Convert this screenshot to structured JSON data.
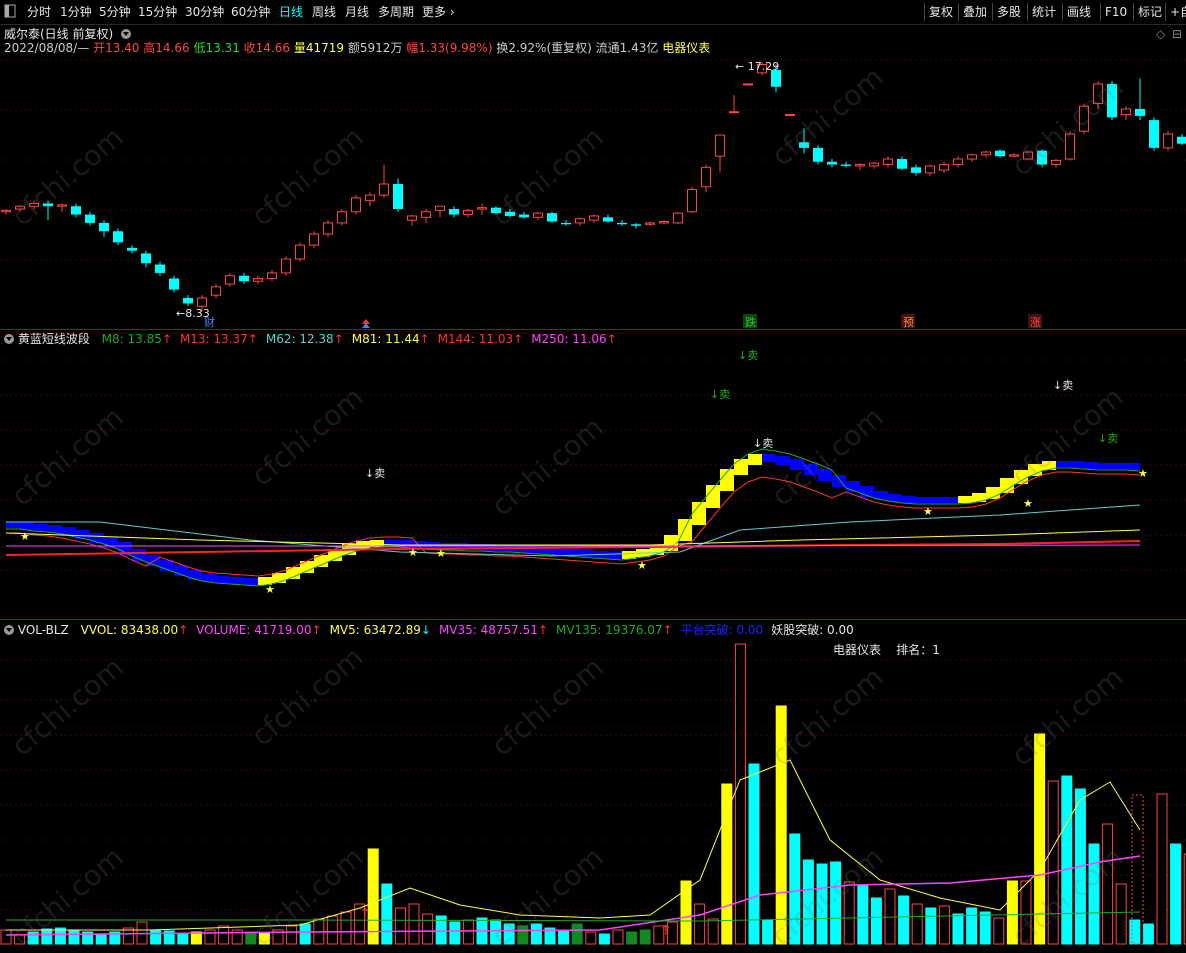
{
  "toolbar": {
    "periods": [
      "分时",
      "1分钟",
      "5分钟",
      "15分钟",
      "30分钟",
      "60分钟",
      "日线",
      "周线",
      "月线",
      "多周期",
      "更多"
    ],
    "active_period": "日线",
    "right_buttons": [
      "复权",
      "叠加",
      "多股",
      "统计",
      "画线",
      "F10",
      "标记",
      "+自"
    ]
  },
  "stock": {
    "title": "威尔泰(日线 前复权)",
    "date": "2022/08/08/—",
    "open_label": "开",
    "open": "13.40",
    "high_label": "高",
    "high": "14.66",
    "low_label": "低",
    "low": "13.31",
    "close_label": "收",
    "close": "14.66",
    "vol_label": "量",
    "vol": "41719",
    "amount_label": "额",
    "amount": "5912万",
    "change_label": "幅",
    "change": "1.33(9.98%)",
    "turnover": "换2.92%(重复权)",
    "float": "流通1.43亿",
    "sector": "电器仪表"
  },
  "price_chart": {
    "max_label": "17.29",
    "min_label": "8.33",
    "markers": [
      "财",
      "跌",
      "预",
      "涨"
    ]
  },
  "indicator_panel": {
    "name": "黄蓝短线波段",
    "items": [
      {
        "label": "M8: 13.85",
        "color": "#22aa22"
      },
      {
        "label": "M13: 13.37",
        "color": "#ff3333"
      },
      {
        "label": "M62: 12.38",
        "color": "#66cccc"
      },
      {
        "label": "M81: 11.44",
        "color": "#ffff44"
      },
      {
        "label": "M144: 11.03",
        "color": "#ff3333"
      },
      {
        "label": "M250: 11.06",
        "color": "#ff44ff"
      }
    ],
    "sell_labels": [
      "卖",
      "卖",
      "卖",
      "卖",
      "卖"
    ]
  },
  "volume_panel": {
    "name": "VOL-BLZ",
    "items": [
      {
        "label": "VVOL: 83438.00",
        "color": "#ffff44",
        "arrow": "↑",
        "arrow_color": "#ff3333"
      },
      {
        "label": "VOLUME: 41719.00",
        "color": "#ff44ff",
        "arrow": "↑",
        "arrow_color": "#ff3333"
      },
      {
        "label": "MV5: 63472.89",
        "color": "#ffff44",
        "arrow": "↓",
        "arrow_color": "#00ffff"
      },
      {
        "label": "MV35: 48757.51",
        "color": "#ff44ff",
        "arrow": "↑",
        "arrow_color": "#ff3333"
      },
      {
        "label": "MV135: 19376.07",
        "color": "#22aa22",
        "arrow": "↑",
        "arrow_color": "#ff3333"
      },
      {
        "label": "平台突破: 0.00",
        "color": "#2222ff",
        "arrow": "",
        "arrow_color": ""
      },
      {
        "label": "妖股突破: 0.00",
        "color": "#e6e6e6",
        "arrow": "",
        "arrow_color": ""
      }
    ],
    "sector_label": "电器仪表",
    "rank_label": "排名：1"
  },
  "watermark": "cfchi.com",
  "colors": {
    "up": "#ff4444",
    "down": "#00ffff",
    "yellow": "#ffff00",
    "blue": "#0000ff",
    "divider": "#8a1a1a"
  }
}
